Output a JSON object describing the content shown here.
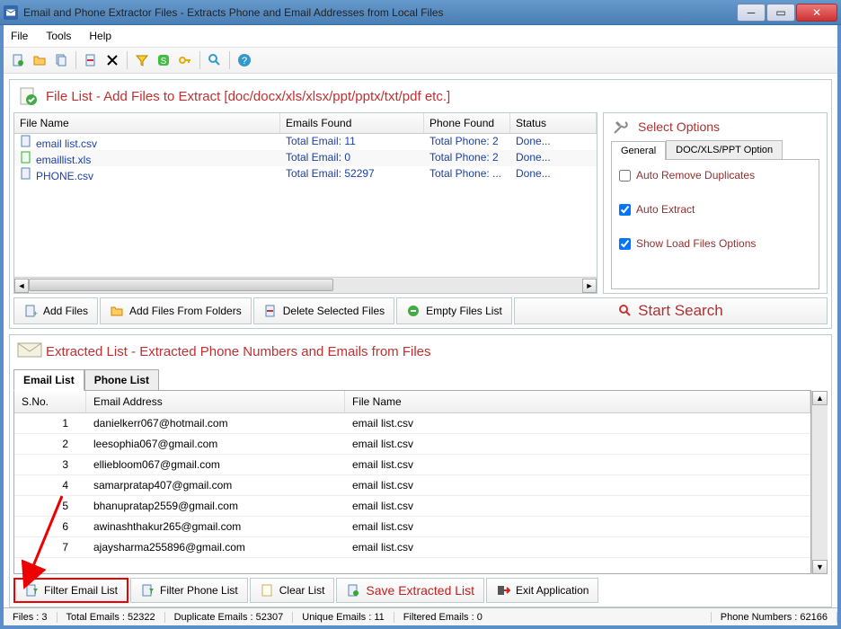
{
  "window": {
    "title": "Email and Phone Extractor Files  -  Extracts Phone and Email Addresses from Local Files"
  },
  "menubar": {
    "items": [
      "File",
      "Tools",
      "Help"
    ]
  },
  "filelist_panel": {
    "title": "File List - Add Files to Extract  [doc/docx/xls/xlsx/ppt/pptx/txt/pdf etc.]",
    "columns": {
      "file_name": "File Name",
      "emails_found": "Emails Found",
      "phone_found": "Phone Found",
      "status": "Status"
    },
    "rows": [
      {
        "name": "email list.csv",
        "emails": "Total Email: 11",
        "phones": "Total Phone: 2",
        "status": "Done..."
      },
      {
        "name": "emaillist.xls",
        "emails": "Total Email: 0",
        "phones": "Total Phone: 2",
        "status": "Done..."
      },
      {
        "name": "PHONE.csv",
        "emails": "Total Email: 52297",
        "phones": "Total Phone: ...",
        "status": "Done..."
      }
    ],
    "buttons": {
      "add_files": "Add Files",
      "add_folders": "Add Files From Folders",
      "delete": "Delete Selected Files",
      "empty": "Empty Files List"
    },
    "start_search": "Start Search"
  },
  "options": {
    "title": "Select Options",
    "tabs": {
      "general": "General",
      "doc": "DOC/XLS/PPT Option"
    },
    "auto_remove": "Auto Remove Duplicates",
    "auto_extract": "Auto Extract",
    "show_load": "Show Load Files Options",
    "auto_remove_checked": false,
    "auto_extract_checked": true,
    "show_load_checked": true
  },
  "extracted": {
    "title": "Extracted List - Extracted Phone Numbers and Emails from Files",
    "tabs": {
      "email": "Email List",
      "phone": "Phone List"
    },
    "columns": {
      "sno": "S.No.",
      "email": "Email Address",
      "file": "File Name"
    },
    "rows": [
      {
        "sno": "1",
        "email": "danielkerr067@hotmail.com",
        "file": "email list.csv"
      },
      {
        "sno": "2",
        "email": "leesophia067@gmail.com",
        "file": "email list.csv"
      },
      {
        "sno": "3",
        "email": "elliebloom067@gmail.com",
        "file": "email list.csv"
      },
      {
        "sno": "4",
        "email": "samarpratap407@gmail.com",
        "file": "email list.csv"
      },
      {
        "sno": "5",
        "email": "bhanupratap2559@gmail.com",
        "file": "email list.csv"
      },
      {
        "sno": "6",
        "email": "awinashthakur265@gmail.com",
        "file": "email list.csv"
      },
      {
        "sno": "7",
        "email": "ajaysharma255896@gmail.com",
        "file": "email list.csv"
      }
    ]
  },
  "footer_buttons": {
    "filter_email": "Filter Email List",
    "filter_phone": "Filter Phone List",
    "clear": "Clear List",
    "save": "Save Extracted List",
    "exit": "Exit Application"
  },
  "statusbar": {
    "files": "Files :  3",
    "total": "Total Emails :  52322",
    "duplicate": "Duplicate Emails :  52307",
    "unique": "Unique Emails :  11",
    "filtered": "Filtered Emails :  0",
    "phones": "Phone Numbers :  62166"
  }
}
